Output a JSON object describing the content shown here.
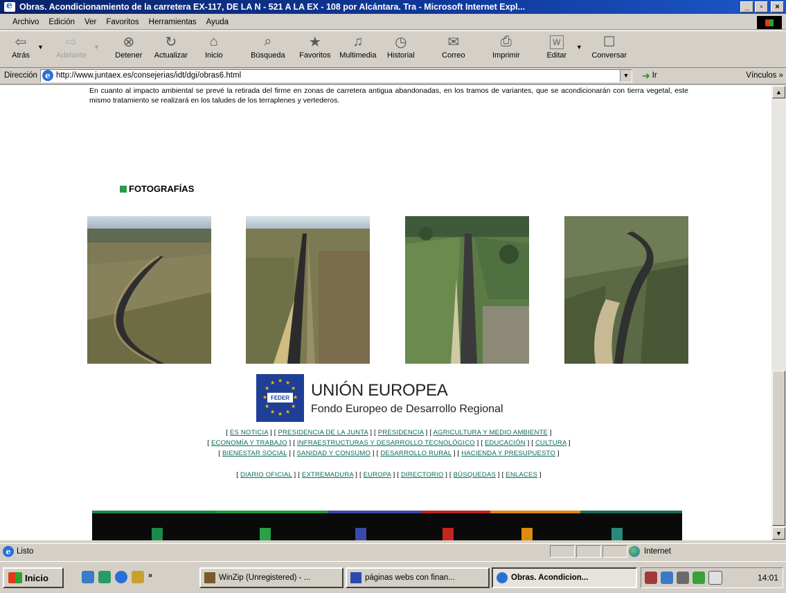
{
  "window": {
    "title": "Obras. Acondicionamiento de la carretera EX-117, DE LA N - 521 A LA EX - 108 por Alcántara. Tra - Microsoft Internet Expl...",
    "controls": [
      "_",
      "▫",
      "×"
    ]
  },
  "menu": [
    "Archivo",
    "Edición",
    "Ver",
    "Favoritos",
    "Herramientas",
    "Ayuda"
  ],
  "toolbar": [
    {
      "label": "Atrás",
      "icon": "back-arrow-icon",
      "glyph": "⇦",
      "dropdown": true
    },
    {
      "label": "Adelante",
      "icon": "forward-arrow-icon",
      "glyph": "⇨",
      "dropdown": true,
      "disabled": true
    },
    {
      "label": "Detener",
      "icon": "stop-icon",
      "glyph": "⊗"
    },
    {
      "label": "Actualizar",
      "icon": "refresh-icon",
      "glyph": "↻"
    },
    {
      "label": "Inicio",
      "icon": "home-icon",
      "glyph": "⌂"
    },
    {
      "label": "Búsqueda",
      "icon": "search-icon",
      "glyph": "⌕"
    },
    {
      "label": "Favoritos",
      "icon": "favorites-icon",
      "glyph": "★"
    },
    {
      "label": "Multimedia",
      "icon": "media-icon",
      "glyph": "♫"
    },
    {
      "label": "Historial",
      "icon": "history-icon",
      "glyph": "◷"
    },
    {
      "label": "Correo",
      "icon": "mail-icon",
      "glyph": "✉"
    },
    {
      "label": "Imprimir",
      "icon": "print-icon",
      "glyph": "⎙"
    },
    {
      "label": "Editar",
      "icon": "edit-icon",
      "glyph": "W"
    },
    {
      "label": "Conversar",
      "icon": "discuss-icon",
      "glyph": "☐"
    }
  ],
  "address": {
    "label": "Dirección",
    "url": "http://www.juntaex.es/consejerias/idt/dgi/obras6.html",
    "go_label": "Ir",
    "links_label": "Vínculos »"
  },
  "page": {
    "intro": "En cuanto al impacto ambiental se prevé la retirada del firme en zonas de carretera antigua abandonadas, en los tramos de variantes, que se acondicionarán con tierra vegetal, este mismo tratamiento se realizará en los taludes de los terraplenes y vertederos.",
    "photos_heading": "FOTOGRAFÍAS",
    "eu_title": "UNIÓN EUROPEA",
    "eu_subtitle": "Fondo Europeo de Desarrollo Regional",
    "eu_badge": "FEDER",
    "nav_links": [
      "ES NOTICIA",
      "PRESIDENCIA DE LA JUNTA",
      "PRESIDENCIA",
      "AGRICULTURA Y MEDIO AMBIENTE",
      "ECONOMÍA Y TRABAJO",
      "INFRAESTRUCTURAS Y DESARROLLO TECNOLÓGICO",
      "EDUCACIÓN",
      "CULTURA",
      "BIENESTAR SOCIAL",
      "SANIDAD Y CONSUMO",
      "DESARROLLO RURAL",
      "HACIENDA Y PRESUPUESTO"
    ],
    "nav_links_2": [
      "DIARIO OFICIAL",
      "EXTREMADURA",
      "EUROPA",
      "DIRECTORIO",
      "BÚSQUEDAS",
      "ENLACES"
    ]
  },
  "status": {
    "text": "Listo",
    "zone": "Internet"
  },
  "taskbar": {
    "start": "Inicio",
    "tasks": [
      "WinZip (Unregistered) - ...",
      "páginas webs con finan...",
      "Obras. Acondicion..."
    ],
    "clock": "14:01"
  },
  "colors": {
    "titlebar": "#0a246a",
    "accent_green": "#2e9b4a",
    "link": "#0a6a5a",
    "eu_blue": "#1f3f97"
  }
}
